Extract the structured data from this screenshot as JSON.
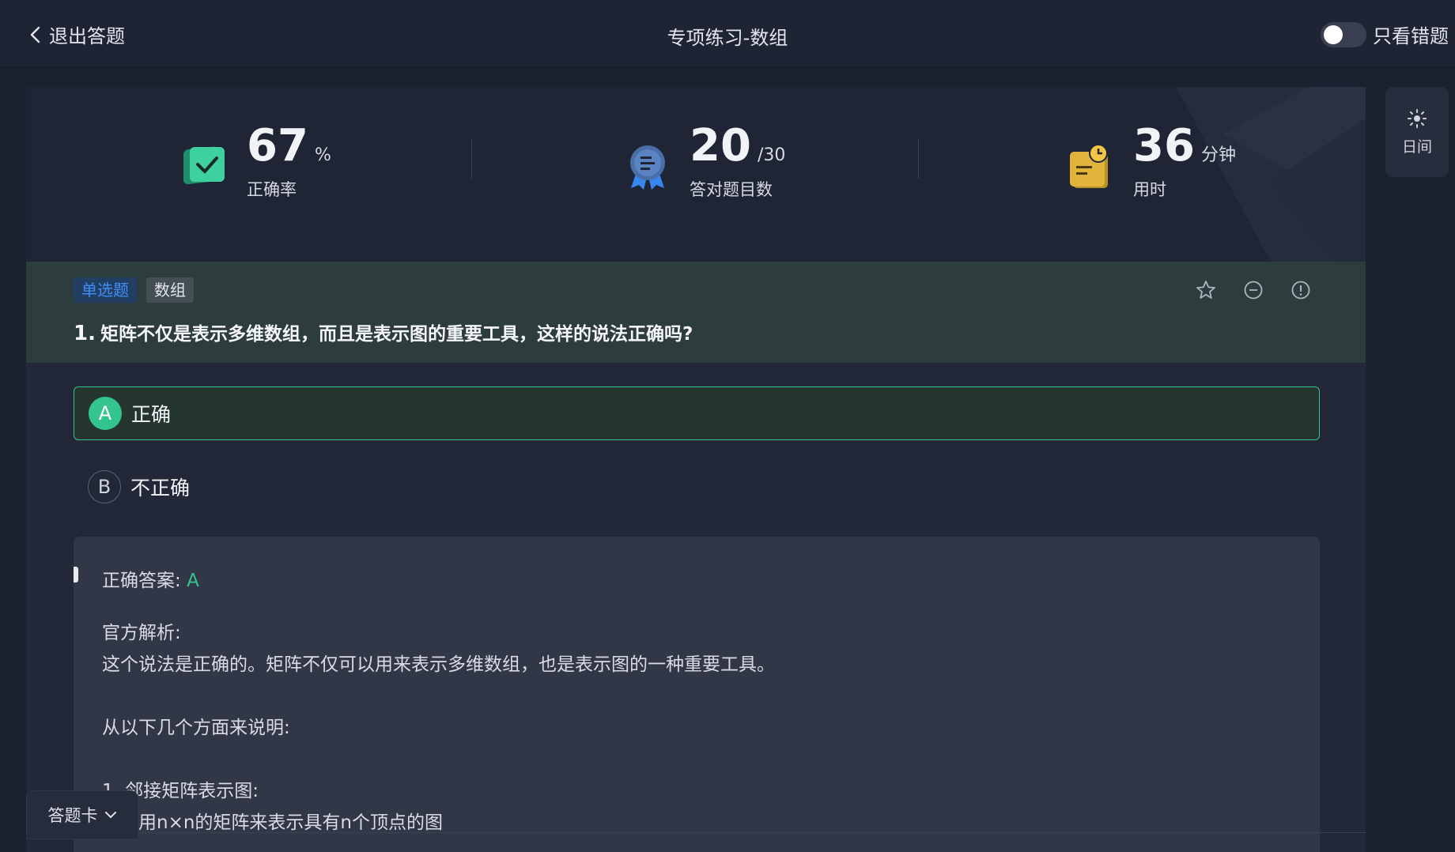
{
  "topbar": {
    "back_label": "退出答题",
    "title": "专项练习-数组",
    "toggle_label": "只看错题",
    "toggle_on": false
  },
  "stats": {
    "accuracy": {
      "value": "67",
      "unit": "%",
      "label": "正确率"
    },
    "correct": {
      "value": "20",
      "unit": "/30",
      "label": "答对题目数"
    },
    "time": {
      "value": "36",
      "unit": "分钟",
      "label": "用时"
    }
  },
  "question": {
    "tags": [
      "单选题",
      "数组"
    ],
    "number": "1.",
    "text": "矩阵不仅是表示多维数组，而且是表示图的重要工具，这样的说法正确吗?",
    "options": [
      {
        "letter": "A",
        "text": "正确",
        "selected": true
      },
      {
        "letter": "B",
        "text": "不正确",
        "selected": false
      }
    ]
  },
  "analysis": {
    "answer_label": "正确答案:",
    "answer_value": "A",
    "official_label": "官方解析:",
    "line1": "这个说法是正确的。矩阵不仅可以用来表示多维数组，也是表示图的一种重要工具。",
    "line2": "从以下几个方面来说明:",
    "line3": "1. 邻接矩阵表示图:",
    "line4": "可以用n×n的矩阵来表示具有n个顶点的图"
  },
  "answer_card": {
    "label": "答题卡"
  },
  "theme": {
    "label": "日间"
  },
  "colors": {
    "accent_green": "#34c48d",
    "tag_blue": "#3f8df5"
  }
}
